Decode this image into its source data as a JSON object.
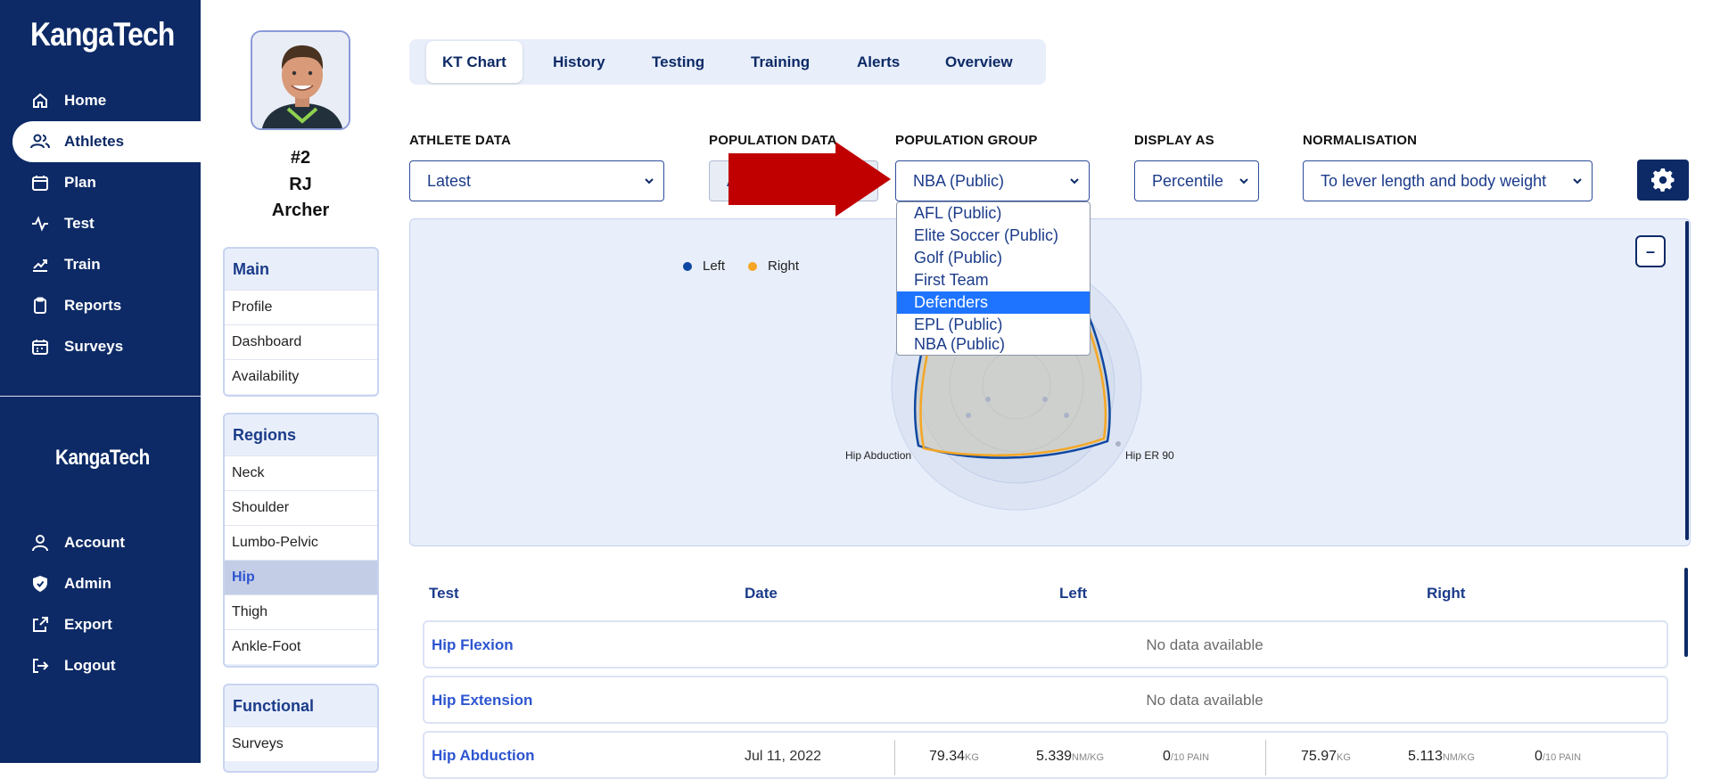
{
  "nav": {
    "brand": "KangaTech",
    "items": [
      {
        "label": "Home",
        "icon": "home-icon"
      },
      {
        "label": "Athletes",
        "icon": "users-icon"
      },
      {
        "label": "Plan",
        "icon": "calendar-icon"
      },
      {
        "label": "Test",
        "icon": "activity-icon"
      },
      {
        "label": "Train",
        "icon": "trend-icon"
      },
      {
        "label": "Reports",
        "icon": "clipboard-icon"
      },
      {
        "label": "Surveys",
        "icon": "calendar-check-icon"
      }
    ],
    "brand2": "KangaTech",
    "bottom_items": [
      {
        "label": "Account",
        "icon": "user-icon"
      },
      {
        "label": "Admin",
        "icon": "shield-icon"
      },
      {
        "label": "Export",
        "icon": "export-icon"
      },
      {
        "label": "Logout",
        "icon": "logout-icon"
      }
    ]
  },
  "athlete": {
    "number": "#2",
    "first_name": "RJ",
    "last_name": "Archer"
  },
  "menus": {
    "main": {
      "title": "Main",
      "items": [
        "Profile",
        "Dashboard",
        "Availability"
      ]
    },
    "regions": {
      "title": "Regions",
      "items": [
        "Neck",
        "Shoulder",
        "Lumbo-Pelvic",
        "Hip",
        "Thigh",
        "Ankle-Foot"
      ],
      "active": "Hip"
    },
    "functional": {
      "title": "Functional",
      "items": [
        "Surveys"
      ]
    }
  },
  "tabs": [
    "KT Chart",
    "History",
    "Testing",
    "Training",
    "Alerts",
    "Overview"
  ],
  "filters": {
    "athlete_data": {
      "label": "ATHLETE DATA",
      "value": "Latest"
    },
    "population_data": {
      "label": "POPULATION DATA",
      "value": "A"
    },
    "population_group": {
      "label": "POPULATION GROUP",
      "value": "NBA (Public)"
    },
    "display_as": {
      "label": "DISPLAY AS",
      "value": "Percentile"
    },
    "normalisation": {
      "label": "NORMALISATION",
      "value": "To lever length and body weight"
    }
  },
  "dropdown": {
    "options": [
      "AFL (Public)",
      "Elite Soccer (Public)",
      "Golf (Public)",
      "First Team",
      "Defenders",
      "EPL (Public)",
      "NBA (Public)"
    ],
    "highlighted": "Defenders"
  },
  "chart": {
    "collapse_label": "–",
    "legend": [
      {
        "name": "Left",
        "color": "#0d47a1"
      },
      {
        "name": "Right",
        "color": "#f5a623"
      }
    ],
    "axis_labels": {
      "hip_abduction": "Hip Abduction",
      "hip_er": "Hip ER 90"
    }
  },
  "table": {
    "headers": {
      "test": "Test",
      "date": "Date",
      "left": "Left",
      "right": "Right"
    },
    "rows": [
      {
        "name": "Hip Flexion",
        "message": "No data available"
      },
      {
        "name": "Hip Extension",
        "message": "No data available"
      },
      {
        "name": "Hip Abduction",
        "date": "Jul 11, 2022",
        "left": [
          {
            "v": "79.34",
            "u": "KG"
          },
          {
            "v": "5.339",
            "u": "NM/KG"
          },
          {
            "v": "0",
            "u": "/10 PAIN"
          }
        ],
        "right": [
          {
            "v": "75.97",
            "u": "KG"
          },
          {
            "v": "5.113",
            "u": "NM/KG"
          },
          {
            "v": "0",
            "u": "/10 PAIN"
          }
        ]
      }
    ]
  },
  "colors": {
    "navy": "#0d2a66",
    "accent_blue": "#2d55d0",
    "arrow_red": "#c00000",
    "highlight": "#1e74ff"
  }
}
